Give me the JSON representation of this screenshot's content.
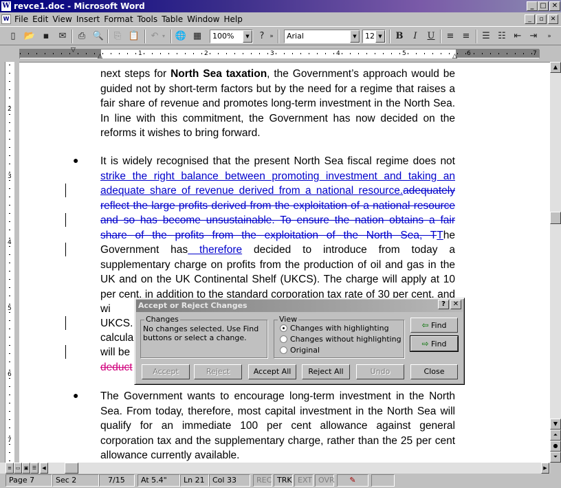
{
  "window": {
    "title": "revce1.doc - Microsoft Word",
    "app_icon": "W"
  },
  "menu": {
    "items": [
      "File",
      "Edit",
      "View",
      "Insert",
      "Format",
      "Tools",
      "Table",
      "Window",
      "Help"
    ]
  },
  "toolbar": {
    "zoom": "100%",
    "font": "Arial",
    "font_size": "12"
  },
  "ruler": {
    "labels": [
      "1",
      "2",
      "3",
      "4",
      "5",
      "6",
      "7"
    ]
  },
  "vruler": {
    "labels": [
      "2",
      "3",
      "4",
      "5",
      "6",
      "7"
    ]
  },
  "document": {
    "p1": {
      "pre": "next steps for ",
      "bold": "North Sea taxation",
      "post": ", the Government’s approach would be guided not by short-term factors but by the need for a regime that raises a fair share of revenue and promotes long-term investment in the North Sea. In line with this commitment, the Government has now decided on the reforms it wishes to bring forward."
    },
    "p2": {
      "t1": "It is widely recognised that the present North Sea fiscal regime does not ",
      "ins1": "strike the right balance between promoting investment and taking an adequate share of revenue derived from a national resource.",
      "del1": "adequately reflect the large profits derived from the exploitation of a national resource and so has become unsustainable. To ensure the nation obtains a fair share of the profits from the exploitation of the North Sea, T",
      "ins2": "T",
      "t2": "he Government has",
      "ins3": " therefore",
      "t3": " decided to introduce from today a supplementary charge on profits from the production of oil and gas in the UK and on the UK Continental Shelf (UKCS). The charge will apply at 10 per cent. in addition to the standard corporation tax rate of 30 per cent. and wi",
      "t4": "UKCS.",
      "t5": "calcula",
      "t6": "will be",
      "del2": "deduct"
    },
    "p3": {
      "text": "The Government wants to encourage long-term investment in the North Sea.  From today, therefore, most capital investment in the North Sea will qualify for an immediate 100 per cent allowance against general corporation tax and the supplementary charge, rather than the 25 per cent allowance currently available."
    }
  },
  "dialog": {
    "title": "Accept or Reject Changes",
    "changes_label": "Changes",
    "changes_text": "No changes selected. Use Find buttons or select a change.",
    "view_label": "View",
    "view_options": [
      "Changes with highlighting",
      "Changes without highlighting",
      "Original"
    ],
    "find_back": "Find",
    "find_fwd": "Find",
    "buttons": {
      "accept": "Accept",
      "reject": "Reject",
      "accept_all": "Accept All",
      "reject_all": "Reject All",
      "undo": "Undo",
      "close": "Close"
    }
  },
  "status": {
    "page": "Page 7",
    "sec": "Sec 2",
    "pages": "7/15",
    "at": "At 5.4\"",
    "ln": "Ln 21",
    "col": "Col 33",
    "rec": "REC",
    "trk": "TRK",
    "ext": "EXT",
    "ovr": "OVR"
  }
}
